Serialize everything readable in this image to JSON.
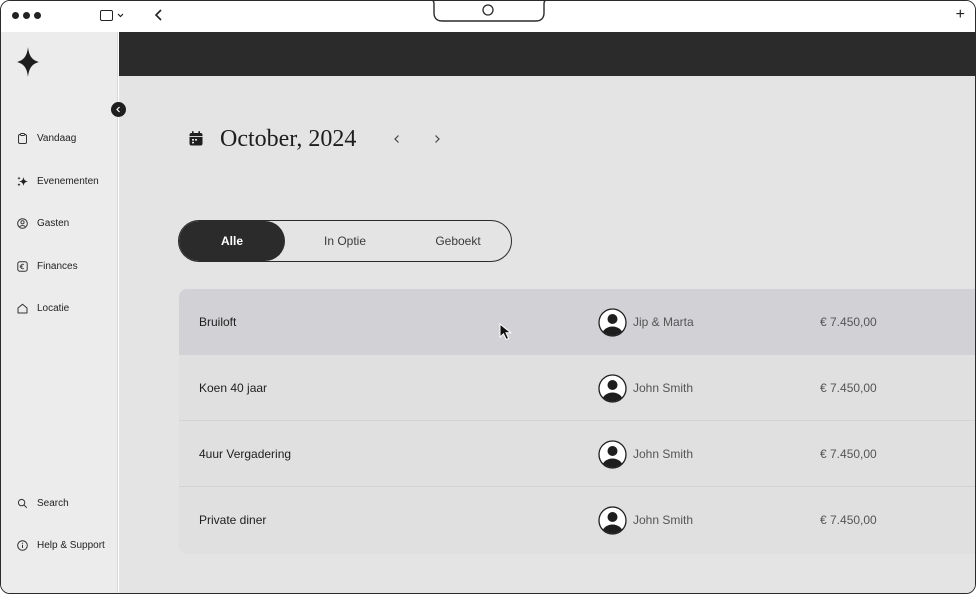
{
  "sidebar": {
    "nav": [
      {
        "label": "Vandaag",
        "icon": "clipboard-icon"
      },
      {
        "label": "Evenementen",
        "icon": "sparkle-icon"
      },
      {
        "label": "Gasten",
        "icon": "user-circle-icon"
      },
      {
        "label": "Finances",
        "icon": "euro-icon"
      },
      {
        "label": "Locatie",
        "icon": "home-icon"
      }
    ],
    "footer": [
      {
        "label": "Search",
        "icon": "search-icon"
      },
      {
        "label": "Help & Support",
        "icon": "info-icon"
      }
    ]
  },
  "header": {
    "month_title": "October, 2024"
  },
  "filters": {
    "items": [
      "Alle",
      "In Optie",
      "Geboekt"
    ],
    "active": "Alle"
  },
  "events": [
    {
      "name": "Bruiloft",
      "guest": "Jip & Marta",
      "price": "€ 7.450,00"
    },
    {
      "name": "Koen 40 jaar",
      "guest": "John Smith",
      "price": "€ 7.450,00"
    },
    {
      "name": "4uur Vergadering",
      "guest": "John Smith",
      "price": "€ 7.450,00"
    },
    {
      "name": "Private diner",
      "guest": "John Smith",
      "price": "€ 7.450,00"
    }
  ],
  "colors": {
    "accent_dark": "#2b2b2b",
    "background": "#e4e4e4",
    "sidebar": "#ececec",
    "row_hover": "#d2d2d6"
  }
}
